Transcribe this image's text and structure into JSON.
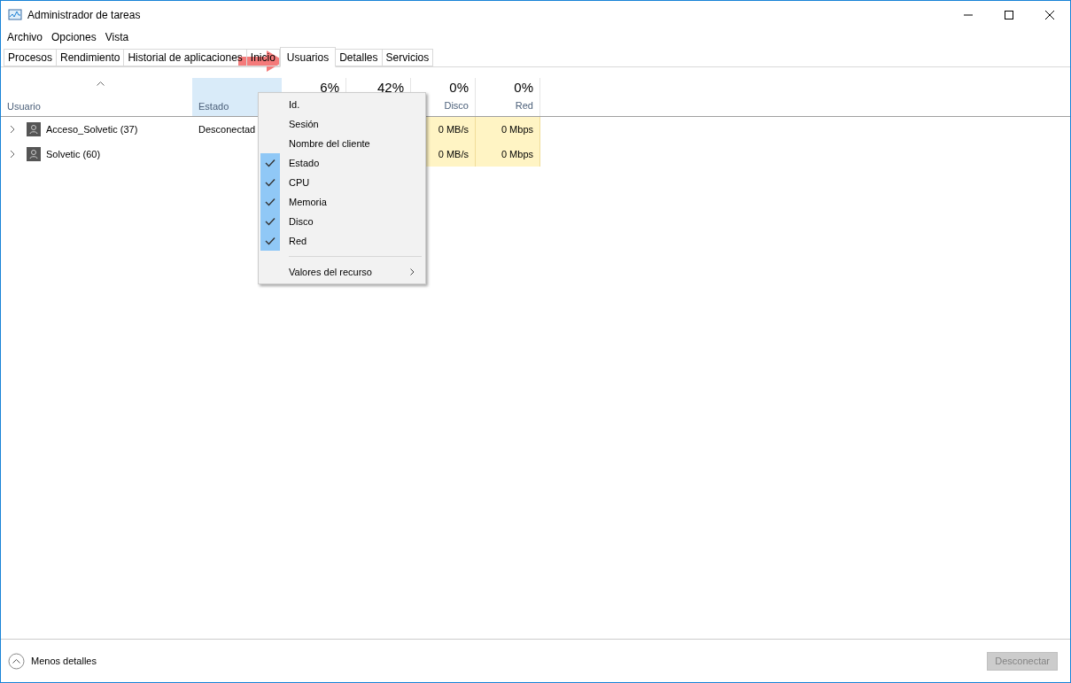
{
  "window": {
    "title": "Administrador de tareas"
  },
  "menu_bar": [
    "Archivo",
    "Opciones",
    "Vista"
  ],
  "tabs": [
    {
      "label": "Procesos",
      "selected": false
    },
    {
      "label": "Rendimiento",
      "selected": false
    },
    {
      "label": "Historial de aplicaciones",
      "selected": false
    },
    {
      "label": "Inicio",
      "selected": false
    },
    {
      "label": "Usuarios",
      "selected": true
    },
    {
      "label": "Detalles",
      "selected": false
    },
    {
      "label": "Servicios",
      "selected": false
    }
  ],
  "table": {
    "columns": [
      {
        "label": "Usuario",
        "sorted": true,
        "highlighted": false
      },
      {
        "label": "Estado",
        "sorted": false,
        "highlighted": true
      },
      {
        "percent": "6%"
      },
      {
        "percent": "42%"
      },
      {
        "percent": "0%",
        "label": "Disco"
      },
      {
        "percent": "0%",
        "label": "Red"
      }
    ],
    "rows": [
      {
        "user": "Acceso_Solvetic (37)",
        "status": "Desconectad",
        "disk": "0 MB/s",
        "network": "0 Mbps",
        "expanded": false
      },
      {
        "user": "Solvetic (60)",
        "disk": "0 MB/s",
        "network": "0 Mbps",
        "expanded": false
      }
    ]
  },
  "context_menu": {
    "items": [
      {
        "label": "Id.",
        "checked": false
      },
      {
        "label": "Sesión",
        "checked": false
      },
      {
        "label": "Nombre del cliente",
        "checked": false
      },
      {
        "label": "Estado",
        "checked": true
      },
      {
        "label": "CPU",
        "checked": true
      },
      {
        "label": "Memoria",
        "checked": true
      },
      {
        "label": "Disco",
        "checked": true
      },
      {
        "label": "Red",
        "checked": true
      }
    ],
    "submenu": "Valores del recurso"
  },
  "footer": {
    "toggle": "Menos detalles",
    "button": {
      "label": "Desconectar",
      "disabled": true
    }
  }
}
